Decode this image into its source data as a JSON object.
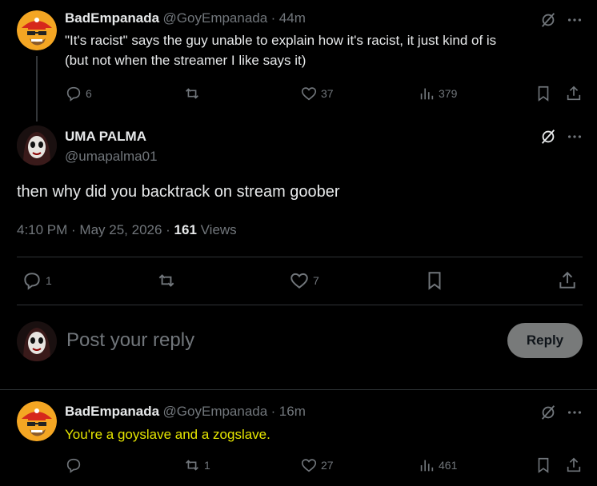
{
  "tweet1": {
    "display_name": "BadEmpanada",
    "handle": "@GoyEmpanada",
    "dot": "·",
    "time": "44m",
    "text_line1": "\"It's racist\" says the guy unable to explain how it's racist, it just kind of is",
    "text_line2": "(but not when the streamer I like says it)",
    "replies": "6",
    "likes": "37",
    "views": "379"
  },
  "main": {
    "display_name": "UMA PALMA",
    "handle": "@umapalma01",
    "text": "then why did you backtrack on stream goober",
    "time": "4:10 PM · May 25, 2026 · ",
    "views_count": "161",
    "views_label": " Views",
    "replies": "1",
    "likes": "7"
  },
  "reply_box": {
    "placeholder": "Post your reply",
    "button": "Reply"
  },
  "tweet2": {
    "display_name": "BadEmpanada",
    "handle": "@GoyEmpanada",
    "dot": "·",
    "time": "16m",
    "text": "You're a goyslave and a zogslave.",
    "retweets": "1",
    "likes": "27",
    "views": "461"
  },
  "colors": {
    "background": "#000000",
    "text": "#e7e9ea",
    "secondary": "#71767b",
    "divider": "#2f3336",
    "highlight_text": "#e5e500",
    "reply_button_bg": "#787a7a"
  },
  "icons": [
    "grok-icon",
    "more-icon",
    "reply-icon",
    "retweet-icon",
    "like-icon",
    "views-icon",
    "bookmark-icon",
    "share-icon"
  ]
}
